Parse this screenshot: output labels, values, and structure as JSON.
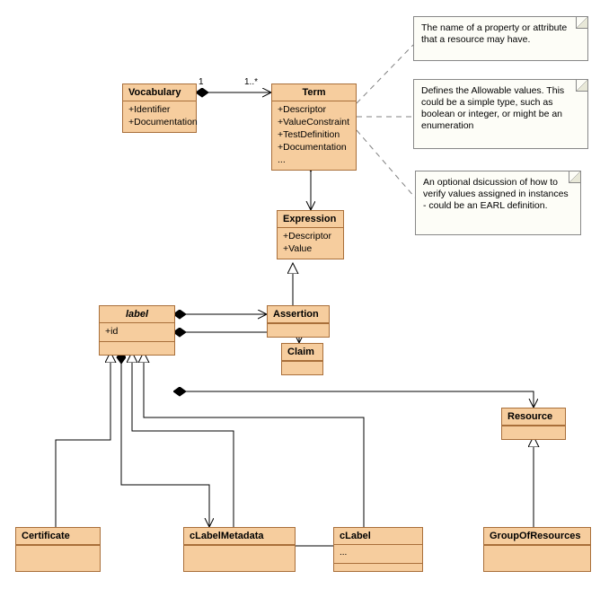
{
  "classes": {
    "vocabulary": {
      "name": "Vocabulary",
      "attrs": [
        "+Identifier",
        "+Documentation"
      ]
    },
    "term": {
      "name": "Term",
      "attrs": [
        "+Descriptor",
        "+ValueConstraint",
        "+TestDefinition",
        "+Documentation",
        "..."
      ]
    },
    "expression": {
      "name": "Expression",
      "attrs": [
        "+Descriptor",
        "+Value"
      ]
    },
    "assertion": {
      "name": "Assertion"
    },
    "claim": {
      "name": "Claim"
    },
    "label": {
      "name": "label",
      "attrs": [
        "+id"
      ]
    },
    "resource": {
      "name": "Resource"
    },
    "certificate": {
      "name": "Certificate"
    },
    "clabelmetadata": {
      "name": "cLabelMetadata"
    },
    "clabel": {
      "name": "cLabel"
    },
    "groupofresources": {
      "name": "GroupOfResources"
    }
  },
  "notes": {
    "n1": "The name of a property or attribute that a resource may have.",
    "n2": "Defines the Allowable values. This could be a simple type, such as boolean or integer, or might be an enumeration",
    "n3": "An optional dsicussion of how to verify values assigned in instances - could be an EARL definition."
  },
  "multiplicities": {
    "voc_side": "1",
    "term_side": "1..*"
  },
  "chart_data": {
    "type": "uml-class-diagram",
    "classes": [
      {
        "name": "Vocabulary",
        "attributes": [
          "Identifier",
          "Documentation"
        ]
      },
      {
        "name": "Term",
        "attributes": [
          "Descriptor",
          "ValueConstraint",
          "TestDefinition",
          "Documentation"
        ]
      },
      {
        "name": "Expression",
        "attributes": [
          "Descriptor",
          "Value"
        ]
      },
      {
        "name": "Assertion"
      },
      {
        "name": "Claim"
      },
      {
        "name": "label",
        "abstract": true,
        "attributes": [
          "id"
        ]
      },
      {
        "name": "Resource"
      },
      {
        "name": "Certificate"
      },
      {
        "name": "cLabelMetadata"
      },
      {
        "name": "cLabel"
      },
      {
        "name": "GroupOfResources"
      }
    ],
    "relationships": [
      {
        "from": "Vocabulary",
        "to": "Term",
        "type": "composition",
        "from_mult": "1",
        "to_mult": "1..*"
      },
      {
        "from": "Term",
        "to": "Expression",
        "type": "composition"
      },
      {
        "from": "Assertion",
        "to": "Expression",
        "type": "generalization"
      },
      {
        "from": "label",
        "to": "Assertion",
        "type": "composition"
      },
      {
        "from": "label",
        "to": "Claim",
        "type": "composition"
      },
      {
        "from": "label",
        "to": "Resource",
        "type": "composition"
      },
      {
        "from": "Certificate",
        "to": "label",
        "type": "generalization"
      },
      {
        "from": "cLabelMetadata",
        "to": "label",
        "type": "generalization"
      },
      {
        "from": "cLabel",
        "to": "label",
        "type": "generalization"
      },
      {
        "from": "cLabel",
        "to": "cLabelMetadata",
        "type": "association"
      },
      {
        "from": "GroupOfResources",
        "to": "Resource",
        "type": "generalization"
      },
      {
        "from": "Term.Descriptor",
        "to": "note1",
        "type": "note-anchor"
      },
      {
        "from": "Term.ValueConstraint",
        "to": "note2",
        "type": "note-anchor"
      },
      {
        "from": "Term.TestDefinition",
        "to": "note3",
        "type": "note-anchor"
      }
    ]
  }
}
